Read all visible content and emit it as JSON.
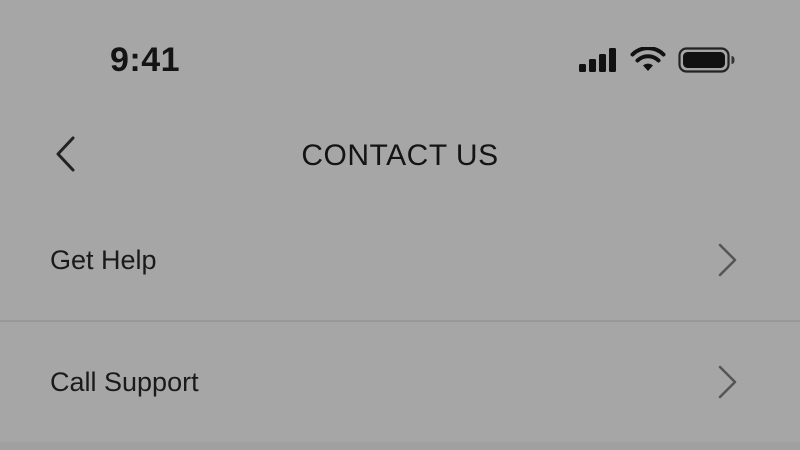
{
  "status_bar": {
    "time": "9:41",
    "icons": [
      "cellular-signal-icon",
      "wifi-icon",
      "battery-icon"
    ]
  },
  "header": {
    "title": "CONTACT US",
    "back_icon": "chevron-left-icon"
  },
  "menu": {
    "items": [
      {
        "label": "Get Help",
        "icon": "chevron-right-icon"
      },
      {
        "label": "Call Support",
        "icon": "chevron-right-icon"
      }
    ]
  },
  "colors": {
    "background": "#a6a6a6",
    "text": "#141414",
    "divider": "#999999",
    "chevron": "#555555"
  }
}
